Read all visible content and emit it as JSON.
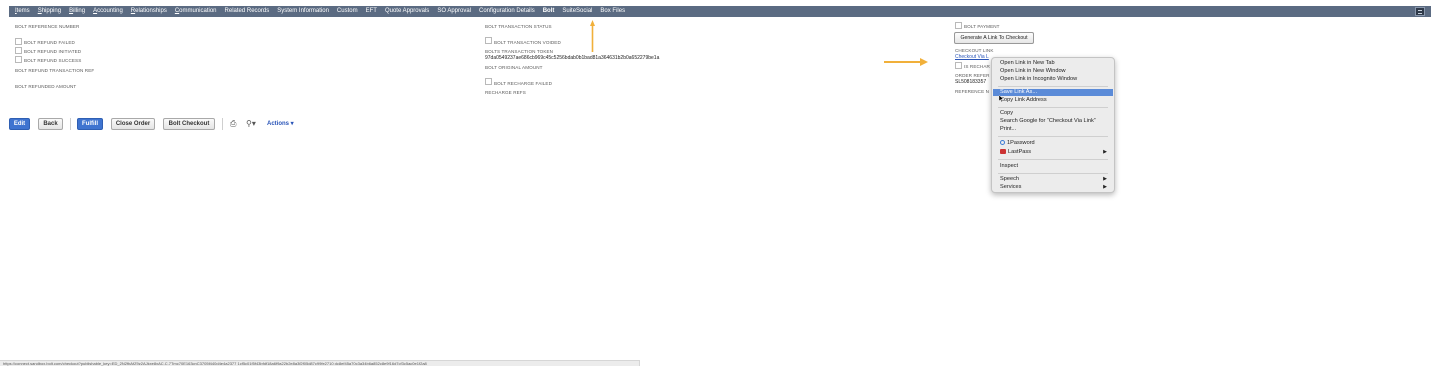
{
  "tabs": [
    {
      "label": "Items",
      "ul": "I",
      "rest": "tems"
    },
    {
      "label": "Shipping",
      "ul": "S",
      "rest": "hipping"
    },
    {
      "label": "Billing",
      "ul": "B",
      "rest": "illing"
    },
    {
      "label": "Accounting",
      "ul": "A",
      "rest": "ccounting"
    },
    {
      "label": "Relationships",
      "ul": "R",
      "rest": "elationships"
    },
    {
      "label": "Communication",
      "ul": "C",
      "rest": "ommunication"
    },
    {
      "label": "Related Records",
      "ul": "",
      "rest": "Related Records"
    },
    {
      "label": "System Information",
      "ul": "",
      "rest": "System Information"
    },
    {
      "label": "Custom",
      "ul": "",
      "rest": "Custom"
    },
    {
      "label": "EFT",
      "ul": "",
      "rest": "EFT"
    },
    {
      "label": "Quote Approvals",
      "ul": "",
      "rest": "Quote Approvals"
    },
    {
      "label": "SO Approval",
      "ul": "",
      "rest": "SO Approval"
    },
    {
      "label": "Configuration Details",
      "ul": "",
      "rest": "Configuration Details"
    },
    {
      "label": "Bolt",
      "ul": "",
      "rest": "Bolt"
    },
    {
      "label": "SuiteSocial",
      "ul": "",
      "rest": "SuiteSocial"
    },
    {
      "label": "Box Files",
      "ul": "",
      "rest": "Box Files"
    }
  ],
  "active_tab": "Bolt",
  "col1": {
    "reference_number_label": "BOLT REFERENCE NUMBER",
    "refund_failed_label": "BOLT REFUND FAILED",
    "refund_initiated_label": "BOLT REFUND INITIATED",
    "refund_success_label": "BOLT REFUND SUCCESS",
    "refund_transaction_ref_label": "BOLT REFUND TRANSACTION REF",
    "refunded_amount_label": "BOLT REFUNDED AMOUNT"
  },
  "col2": {
    "transaction_status_label": "BOLT TRANSACTION STATUS",
    "transaction_voided_label": "BOLT TRANSACTION VOIDED",
    "transaction_token_label": "BOLTS TRANSACTION TOKEN",
    "transaction_token_value": "97da0549237ae686cb969c45c5256bdab0b1bad81a364631b2b0a652279be1a",
    "original_amount_label": "BOLT ORIGINAL AMOUNT",
    "recharge_failed_label": "BOLT RECHARGE FAILED",
    "recharge_refs_label": "RECHARGE REFS"
  },
  "col3": {
    "bolt_payment_label": "BOLT PAYMENT",
    "generate_button": "Generate A Link To Checkout",
    "checkout_link_label": "CHECKOUT LINK",
    "checkout_link_value": "Checkout Via L",
    "is_recharge_label": "IS RECHAR",
    "order_ref_label": "ORDER REFER",
    "order_ref_value": "SL508183357",
    "reference_label": "REFERENCE N"
  },
  "buttons": {
    "edit": "Edit",
    "back": "Back",
    "fulfill": "Fulfill",
    "close_order": "Close Order",
    "bolt_checkout": "Bolt Checkout",
    "actions": "Actions"
  },
  "context_menu": {
    "open_new_tab": "Open Link in New Tab",
    "open_new_window": "Open Link in New Window",
    "open_incognito": "Open Link in Incognito Window",
    "save_link_as": "Save Link As...",
    "copy_link_address": "Copy Link Address",
    "copy": "Copy",
    "search_google": "Search Google for “Checkout Via Link”",
    "print": "Print...",
    "onepassword": "1Password",
    "lastpass": "LastPass",
    "inspect": "Inspect",
    "speech": "Speech",
    "services": "Services",
    "highlighted": "Save Link As..."
  },
  "status_bar": "https://connect.sandbox.bolt.com/checkout?publishable_key=ED_2N2fbAfZ9z2AJkxe8xAC.C.7Tmc70E163cnC3705f440d4e4a2377 1cf5c01f5f43bfdf18a6f9a22b2e8a3f2f05d87c99fe2710 dc8ef45a70c3a34b6a852c8e9f16d7cf3c5ac0e1f2a8",
  "colors": {
    "tabbar": "#5b6b82",
    "primary_button": "#3f74d0",
    "link": "#2a55b8",
    "arrow": "#f1b03a",
    "menu_highlight": "#5b8bd8"
  }
}
